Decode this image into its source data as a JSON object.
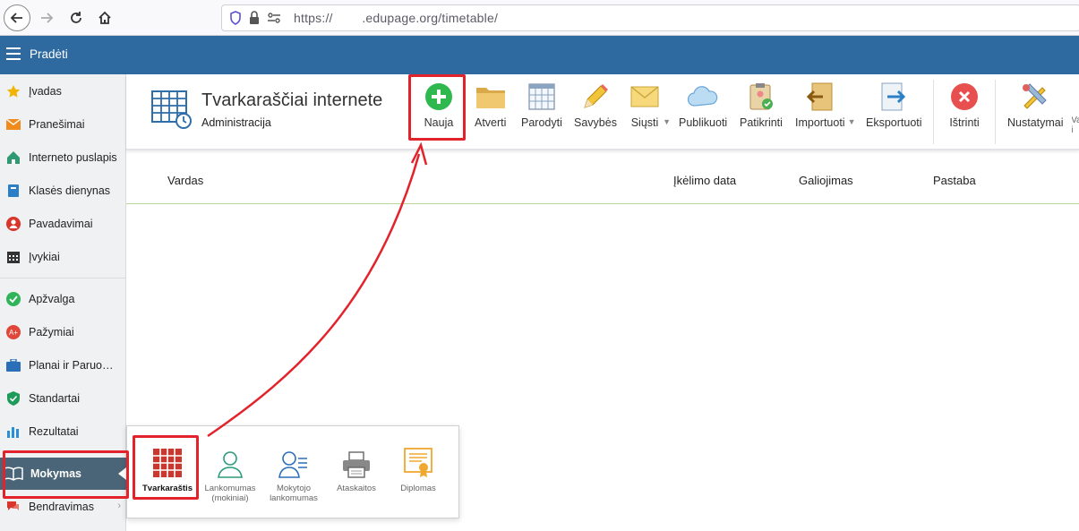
{
  "browser": {
    "url_scheme": "https://",
    "url_domain": ".edupage.org/timetable/"
  },
  "appbar": {
    "title": "Pradėti"
  },
  "sidebar": {
    "items": [
      {
        "label": "Įvadas",
        "icon": "star-icon"
      },
      {
        "label": "Pranešimai",
        "icon": "envelope-icon"
      },
      {
        "label": "Interneto puslapis",
        "icon": "home-icon"
      },
      {
        "label": "Klasės dienynas",
        "icon": "book-icon"
      },
      {
        "label": "Pavadavimai",
        "icon": "person-icon"
      },
      {
        "label": "Įvykiai",
        "icon": "calendar-icon"
      },
      {
        "label": "Apžvalga",
        "icon": "check-circle-icon"
      },
      {
        "label": "Pažymiai",
        "icon": "grade-icon"
      },
      {
        "label": "Planai ir Paruošimas",
        "icon": "briefcase-icon"
      },
      {
        "label": "Standartai",
        "icon": "shield-check-icon"
      },
      {
        "label": "Rezultatai",
        "icon": "bar-chart-icon"
      },
      {
        "label": "Mokymas",
        "icon": "open-book-icon",
        "active": true
      },
      {
        "label": "Bendravimas",
        "icon": "chat-icon"
      }
    ]
  },
  "header": {
    "title": "Tvarkaraščiai internete",
    "subtitle": "Administracija"
  },
  "toolbar": {
    "buttons": [
      {
        "label": "Nauja",
        "icon": "plus-circle-icon"
      },
      {
        "label": "Atverti",
        "icon": "folder-icon"
      },
      {
        "label": "Parodyti",
        "icon": "grid-icon"
      },
      {
        "label": "Savybės",
        "icon": "pencil-icon"
      },
      {
        "label": "Siųsti",
        "icon": "mail-icon"
      },
      {
        "label": "Publikuoti",
        "icon": "cloud-icon"
      },
      {
        "label": "Patikrinti",
        "icon": "clipboard-check-icon"
      },
      {
        "label": "Importuoti",
        "icon": "import-icon"
      },
      {
        "label": "Eksportuoti",
        "icon": "export-icon"
      },
      {
        "label": "Ištrinti",
        "icon": "delete-icon"
      },
      {
        "label": "Nustatymai",
        "icon": "settings-tools-icon"
      },
      {
        "label": "Va i",
        "icon": ""
      }
    ]
  },
  "table": {
    "columns": [
      "Vardas",
      "Įkėlimo data",
      "Galiojimas",
      "Pastaba"
    ]
  },
  "popup": {
    "items": [
      {
        "label": "Tvarkaraštis",
        "icon": "timetable-icon",
        "active": true
      },
      {
        "label": "Lankomumas (mokiniai)",
        "icon": "student-icon"
      },
      {
        "label": "Mokytojo lankomumas",
        "icon": "teacher-icon"
      },
      {
        "label": "Ataskaitos",
        "icon": "printer-icon"
      },
      {
        "label": "Diplomas",
        "icon": "diploma-icon"
      }
    ]
  },
  "colors": {
    "appbar": "#2e6aa0",
    "highlight": "#e3232b",
    "sidebar_active": "#4a6478"
  }
}
